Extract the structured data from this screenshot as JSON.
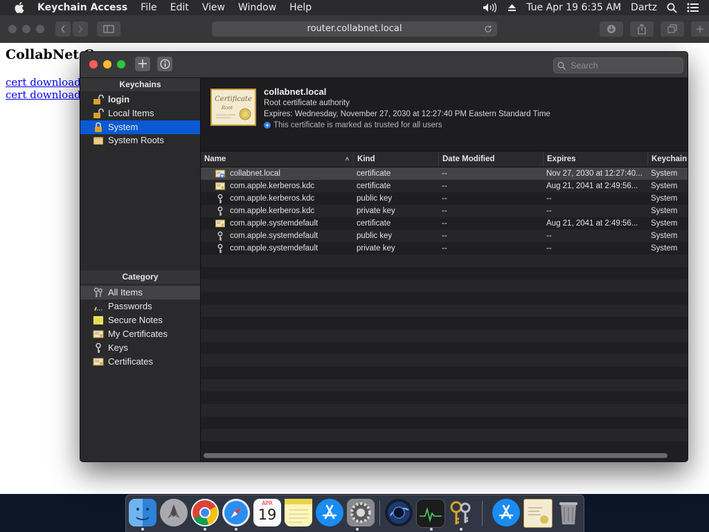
{
  "menubar": {
    "app_name": "Keychain Access",
    "menus": [
      "File",
      "Edit",
      "View",
      "Window",
      "Help"
    ],
    "clock": "Tue Apr 19  6:35 AM",
    "user": "Dartz"
  },
  "safari": {
    "url": "router.collabnet.local",
    "page": {
      "heading": "CollabNet Ce",
      "links": [
        "cert download (I",
        "cert download (E"
      ]
    }
  },
  "keychain_window": {
    "search_placeholder": "Search",
    "sidebar": {
      "keychains_header": "Keychains",
      "keychains": [
        {
          "label": "login",
          "icon": "lock-open-icon"
        },
        {
          "label": "Local Items",
          "icon": "lock-open-icon"
        },
        {
          "label": "System",
          "icon": "lock-open-icon"
        },
        {
          "label": "System Roots",
          "icon": "folder-icon"
        }
      ],
      "category_header": "Category",
      "categories": [
        {
          "label": "All Items",
          "icon": "all-items-icon"
        },
        {
          "label": "Passwords",
          "icon": "password-icon"
        },
        {
          "label": "Secure Notes",
          "icon": "note-icon"
        },
        {
          "label": "My Certificates",
          "icon": "certificate-icon"
        },
        {
          "label": "Keys",
          "icon": "key-icon"
        },
        {
          "label": "Certificates",
          "icon": "certificate-icon"
        }
      ]
    },
    "detail": {
      "name": "collabnet.local",
      "subtitle": "Root certificate authority",
      "expires": "Expires: Wednesday, November 27, 2030 at 12:27:40 PM Eastern Standard Time",
      "trust_note": "This certificate is marked as trusted for all users",
      "thumbnail_text": "Certificate",
      "thumbnail_sub": "Root"
    },
    "table": {
      "columns": [
        "Name",
        "Kind",
        "Date Modified",
        "Expires",
        "Keychain"
      ],
      "rows": [
        {
          "name": "collabnet.local",
          "kind": "certificate",
          "modified": "--",
          "expires": "Nov 27, 2030 at 12:27:40...",
          "keychain": "System",
          "icon": "certificate-trusted-icon"
        },
        {
          "name": "com.apple.kerberos.kdc",
          "kind": "certificate",
          "modified": "--",
          "expires": "Aug 21, 2041 at 2:49:56...",
          "keychain": "System",
          "icon": "certificate-icon"
        },
        {
          "name": "com.apple.kerberos.kdc",
          "kind": "public key",
          "modified": "--",
          "expires": "--",
          "keychain": "System",
          "icon": "key-icon"
        },
        {
          "name": "com.apple.kerberos.kdc",
          "kind": "private key",
          "modified": "--",
          "expires": "--",
          "keychain": "System",
          "icon": "key-icon"
        },
        {
          "name": "com.apple.systemdefault",
          "kind": "certificate",
          "modified": "--",
          "expires": "Aug 21, 2041 at 2:49:56...",
          "keychain": "System",
          "icon": "certificate-icon"
        },
        {
          "name": "com.apple.systemdefault",
          "kind": "public key",
          "modified": "--",
          "expires": "--",
          "keychain": "System",
          "icon": "key-icon"
        },
        {
          "name": "com.apple.systemdefault",
          "kind": "private key",
          "modified": "--",
          "expires": "--",
          "keychain": "System",
          "icon": "key-icon"
        }
      ]
    }
  },
  "dock": {
    "calendar_month": "APR",
    "calendar_day": "19",
    "apps": [
      "finder-icon",
      "launchpad-icon",
      "chrome-icon",
      "safari-icon",
      "calendar-icon",
      "notes-icon",
      "app-store-icon",
      "system-preferences-icon",
      "cinema4d-icon",
      "activity-monitor-icon",
      "keychain-access-icon",
      "app-store-folder-icon",
      "certificate-file-icon",
      "trash-icon"
    ]
  },
  "colors": {
    "selection_blue": "#0a59d3",
    "window_bg": "#1f1f21",
    "link_blue": "#0000ee"
  }
}
